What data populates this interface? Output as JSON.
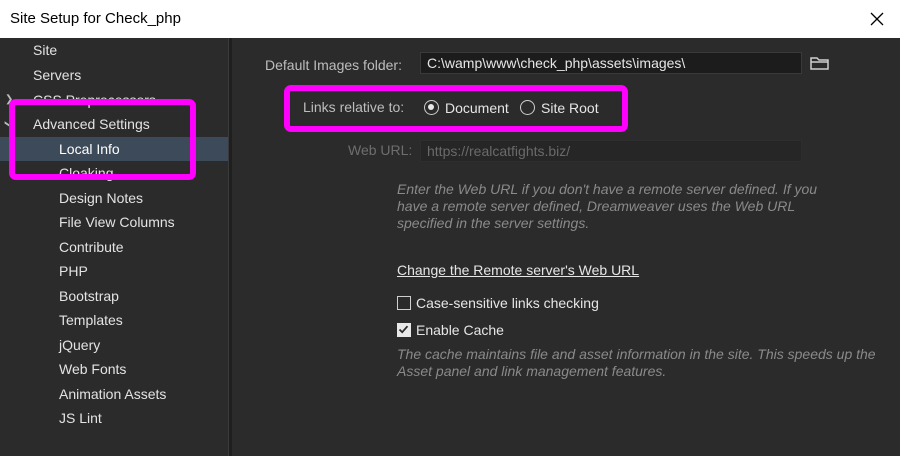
{
  "window": {
    "title": "Site Setup for Check_php"
  },
  "sidebar": {
    "items": [
      {
        "label": "Site",
        "level": 0
      },
      {
        "label": "Servers",
        "level": 0
      },
      {
        "label": "CSS Preprocessors",
        "level": 0
      },
      {
        "label": "Advanced Settings",
        "level": 0
      },
      {
        "label": "Local Info",
        "level": 1,
        "selected": true
      },
      {
        "label": "Cloaking",
        "level": 1
      },
      {
        "label": "Design Notes",
        "level": 1
      },
      {
        "label": "File View Columns",
        "level": 1
      },
      {
        "label": "Contribute",
        "level": 1
      },
      {
        "label": "PHP",
        "level": 1
      },
      {
        "label": "Bootstrap",
        "level": 1
      },
      {
        "label": "Templates",
        "level": 1
      },
      {
        "label": "jQuery",
        "level": 1
      },
      {
        "label": "Web Fonts",
        "level": 1
      },
      {
        "label": "Animation Assets",
        "level": 1
      },
      {
        "label": "JS Lint",
        "level": 1
      }
    ]
  },
  "main": {
    "images_folder_label": "Default Images folder:",
    "images_folder_value": "C:\\wamp\\www\\check_php\\assets\\images\\",
    "links_relative_label": "Links relative to:",
    "radio_document": "Document",
    "radio_site_root": "Site Root",
    "web_url_label": "Web URL:",
    "web_url_value": "https://realcatfights.biz/",
    "web_url_note": "Enter the Web URL if you don't have a remote server defined. If you have a remote server defined, Dreamweaver uses the Web URL specified in the server settings.",
    "change_link": "Change the Remote server's Web URL",
    "case_sensitive_label": "Case-sensitive links checking",
    "enable_cache_label": "Enable Cache",
    "cache_note": "The cache maintains file and asset information in the site. This speeds up the Asset panel and link management features."
  },
  "colors": {
    "highlight": "#ff00ff",
    "selected_row": "#3c4a5a"
  }
}
